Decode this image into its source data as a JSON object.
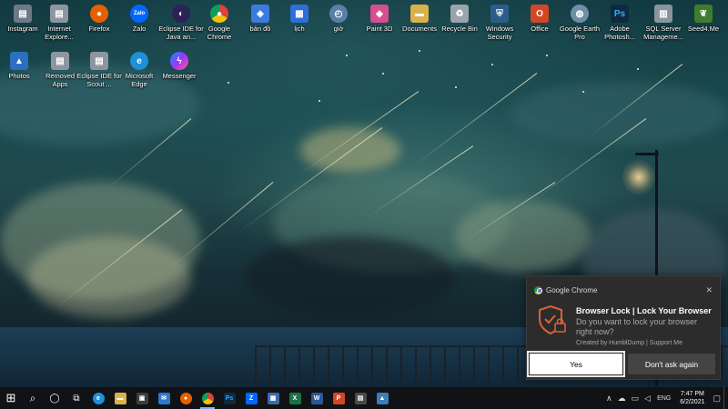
{
  "desktop": {
    "row1": [
      {
        "label": "Instagram",
        "icon": "instagram-icon",
        "color": "#6c7a86"
      },
      {
        "label": "Internet Explore...",
        "icon": "file-icon",
        "color": "#8d96a0"
      },
      {
        "label": "Firefox",
        "icon": "firefox-icon",
        "color": "#e66000"
      },
      {
        "label": "Zalo",
        "icon": "zalo-icon",
        "color": "#0068ff"
      },
      {
        "label": "Eclipse IDE for Java an...",
        "icon": "eclipse-icon",
        "color": "#2c2255"
      },
      {
        "label": "Google Chrome",
        "icon": "chrome-icon",
        "color": "#db4437"
      },
      {
        "label": "bản đồ",
        "icon": "map-icon",
        "color": "#3b7be0"
      },
      {
        "label": "lịch",
        "icon": "calendar-icon",
        "color": "#2d6fd8"
      },
      {
        "label": "giờ",
        "icon": "clock-icon",
        "color": "#5a7fa8"
      },
      {
        "label": "Paint 3D",
        "icon": "paint3d-icon",
        "color": "#d64f8e"
      },
      {
        "label": "Documents",
        "icon": "folder-icon",
        "color": "#d8b24a"
      },
      {
        "label": "Recycle Bin",
        "icon": "recycle-bin-icon",
        "color": "#9aa4ad"
      },
      {
        "label": "Windows Security",
        "icon": "shield-icon",
        "color": "#2c5d8a"
      },
      {
        "label": "Office",
        "icon": "office-icon",
        "color": "#d24726"
      },
      {
        "label": "Google Earth Pro",
        "icon": "earth-icon",
        "color": "#6f8fa6"
      },
      {
        "label": "Adobe Photosh...",
        "icon": "photoshop-icon",
        "color": "#0f2a3f"
      },
      {
        "label": "SQL Server Manageme...",
        "icon": "sql-server-icon",
        "color": "#8a949d"
      },
      {
        "label": "Seed4.Me",
        "icon": "seed4me-icon",
        "color": "#3e7d2e"
      }
    ],
    "row2": [
      {
        "label": "Photos",
        "icon": "photos-icon",
        "color": "#2a6fc0"
      },
      {
        "label": "Removed Apps",
        "icon": "file-icon",
        "color": "#8d96a0"
      },
      {
        "label": "Eclipse IDE for Scout ...",
        "icon": "file-icon",
        "color": "#8d96a0"
      },
      {
        "label": "Microsoft Edge",
        "icon": "edge-icon",
        "color": "#1f8fd8"
      },
      {
        "label": "Messenger",
        "icon": "messenger-icon",
        "color": "#a033ff"
      }
    ]
  },
  "notification": {
    "app_name": "Google Chrome",
    "close_glyph": "✕",
    "title": "Browser Lock | Lock Your Browser",
    "message": "Do you want to lock your browser right now?",
    "attribution": "Created by HumblDump | Support Me",
    "yes_label": "Yes",
    "dont_ask_label": "Don't ask again",
    "accent": "#d9623b"
  },
  "taskbar": {
    "start_glyph": "⊞",
    "search_glyph": "⌕",
    "cortana_glyph": "◯",
    "taskview_glyph": "⧉",
    "apps": [
      {
        "name": "taskbar-edge",
        "icon": "edge-icon",
        "glyph": "e",
        "color": "#1f8fd8",
        "active": false
      },
      {
        "name": "taskbar-explorer",
        "icon": "folder-icon",
        "glyph": "▬",
        "color": "#d8b24a",
        "active": false
      },
      {
        "name": "taskbar-store",
        "icon": "store-icon",
        "glyph": "▣",
        "color": "#3d3d3d",
        "active": false
      },
      {
        "name": "taskbar-mail",
        "icon": "mail-icon",
        "glyph": "✉",
        "color": "#2b78d0",
        "active": false
      },
      {
        "name": "taskbar-firefox",
        "icon": "firefox-icon",
        "glyph": "●",
        "color": "#e66000",
        "active": false
      },
      {
        "name": "taskbar-chrome",
        "icon": "chrome-icon",
        "glyph": "●",
        "color": "#db4437",
        "active": true
      },
      {
        "name": "taskbar-photoshop",
        "icon": "photoshop-icon",
        "glyph": "Ps",
        "color": "#0f2a3f",
        "active": false
      },
      {
        "name": "taskbar-zalo",
        "icon": "zalo-icon",
        "glyph": "Z",
        "color": "#0068ff",
        "active": false
      },
      {
        "name": "taskbar-photos",
        "icon": "photos-icon",
        "glyph": "▦",
        "color": "#3c6aa8",
        "active": false
      },
      {
        "name": "taskbar-excel",
        "icon": "excel-icon",
        "glyph": "X",
        "color": "#1e7145",
        "active": false
      },
      {
        "name": "taskbar-word",
        "icon": "word-icon",
        "glyph": "W",
        "color": "#2b579a",
        "active": false
      },
      {
        "name": "taskbar-powerpoint",
        "icon": "powerpoint-icon",
        "glyph": "P",
        "color": "#d24726",
        "active": false
      },
      {
        "name": "taskbar-app",
        "icon": "app-icon",
        "glyph": "▤",
        "color": "#4a4a4a",
        "active": false
      },
      {
        "name": "taskbar-image",
        "icon": "image-icon",
        "glyph": "▲",
        "color": "#3c7fb8",
        "active": false
      }
    ],
    "tray": {
      "chevron": "∧",
      "cloud": "☁",
      "network": "▭",
      "volume": "◁",
      "language": "ENG",
      "time": "7:47 PM",
      "date": "6/2/2021",
      "notifications": "▢"
    }
  }
}
